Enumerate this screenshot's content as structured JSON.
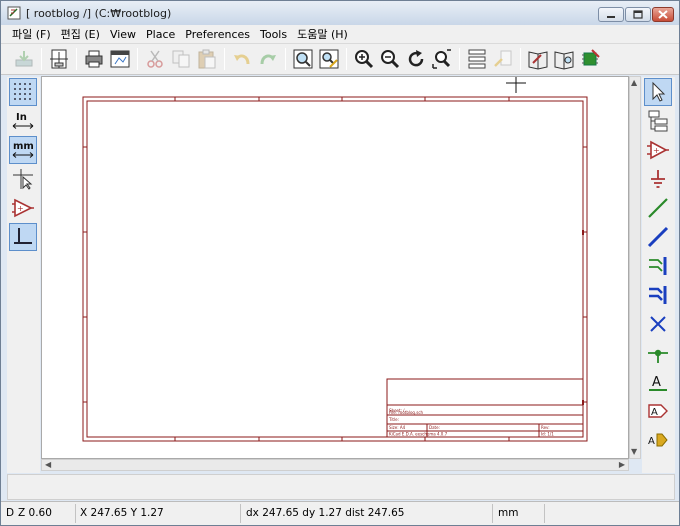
{
  "window": {
    "title": "[ rootblog /] (C:₩rootblog)"
  },
  "menu": [
    "파일 (F)",
    "편집 (E)",
    "View",
    "Place",
    "Preferences",
    "Tools",
    "도움말 (H)"
  ],
  "status": {
    "zoom": "Z 0.60",
    "zoom_prefix": "D",
    "cursor": "X 247.65  Y 1.27",
    "delta": "dx 247.65  dy 1.27  dist 247.65",
    "units": "mm"
  },
  "titleblock": {
    "sheet": "Sheet: /",
    "file": "File: rootblog.sch",
    "title": "Title:",
    "size": "Size: A4",
    "date": "Date:",
    "rev": "Rev:",
    "kicad": "KiCad E.D.A.  eeschema 4.0.7",
    "id": "Id: 1/1"
  },
  "colors": {
    "sheet_border": "#8b1a1a",
    "accent": "#3a76c4"
  }
}
